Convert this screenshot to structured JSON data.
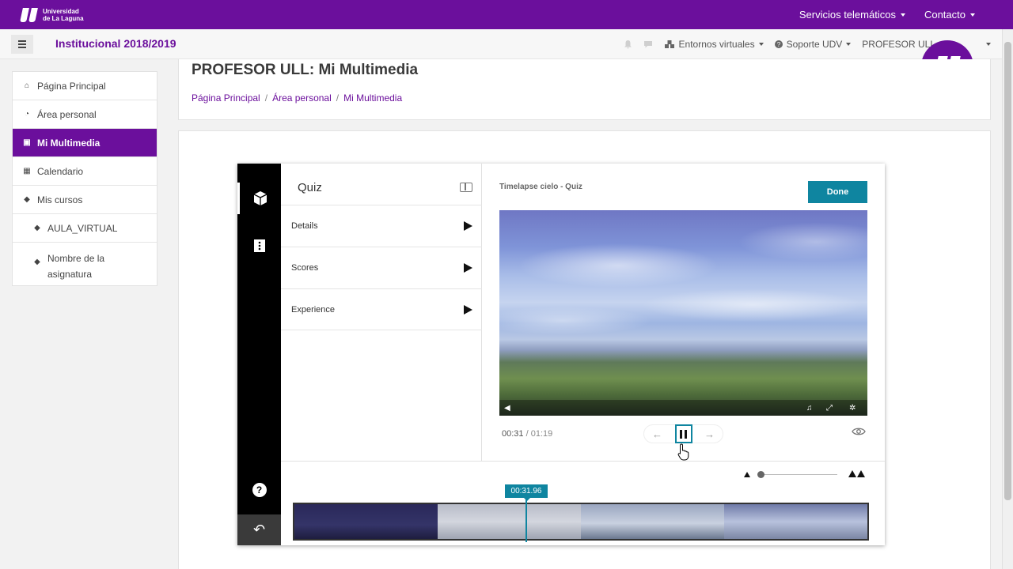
{
  "brand": {
    "line1": "Universidad",
    "line2": "de La Laguna"
  },
  "topnav": {
    "services": "Servicios telemáticos",
    "contact": "Contacto"
  },
  "navbar": {
    "site_title": "Institucional 2018/2019",
    "virtual_envs": "Entornos virtuales",
    "support": "Soporte UDV",
    "user": "PROFESOR ULL"
  },
  "sidebar": {
    "items": [
      {
        "label": "Página Principal",
        "icon": "home-icon"
      },
      {
        "label": "Área personal",
        "icon": "dashboard-icon"
      },
      {
        "label": "Mi Multimedia",
        "icon": "multimedia-icon"
      },
      {
        "label": "Calendario",
        "icon": "calendar-icon"
      },
      {
        "label": "Mis cursos",
        "icon": "graduation-cap-icon"
      },
      {
        "label": "AULA_VIRTUAL",
        "icon": "graduation-cap-icon"
      },
      {
        "label": "Nombre de la asignatura",
        "icon": "graduation-cap-icon"
      }
    ]
  },
  "header": {
    "title": "PROFESOR ULL: Mi Multimedia",
    "breadcrumb": [
      "Página Principal",
      "Área personal",
      "Mi Multimedia"
    ]
  },
  "editor": {
    "panel_title": "Quiz",
    "panel_rows": [
      "Details",
      "Scores",
      "Experience"
    ],
    "preview_title": "Timelapse cielo - Quiz",
    "done_label": "Done",
    "current_time": "00:31",
    "time_sep": "/",
    "total_time": "01:19",
    "playhead_time": "00:31.96",
    "help_glyph": "?"
  },
  "colors": {
    "brand_purple": "#6b0f9c",
    "accent_teal": "#0f85a0"
  }
}
